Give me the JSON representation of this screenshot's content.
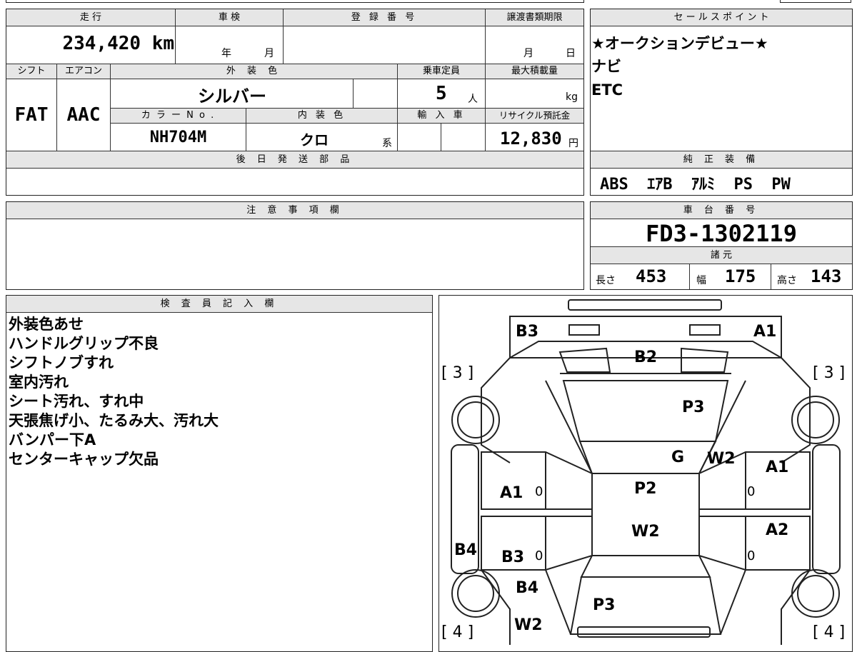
{
  "header": {
    "mileage_label": "走 行",
    "inspection_label": "車 検",
    "registration_label": "登 録 番 号",
    "transfer_label": "譲渡書類期限",
    "sales_points_label": "セ ー ル ス ポ イ ン ト"
  },
  "mileage": {
    "value": "234,420",
    "unit": "km"
  },
  "inspection": {
    "year": "年",
    "month": "月"
  },
  "transfer": {
    "month": "月",
    "day": "日"
  },
  "row2_labels": {
    "shift": "シフト",
    "aircon": "エアコン",
    "exterior_color": "外 装 色",
    "capacity": "乗車定員",
    "max_load": "最大積載量"
  },
  "shift": "FAT",
  "aircon": "AAC",
  "exterior_color": "シルバー",
  "capacity": {
    "value": "5",
    "unit": "人"
  },
  "max_load_unit": "kg",
  "row3_labels": {
    "color_no": "カ ラ ー N o .",
    "interior": "内 装 色",
    "import": "輸 入 車",
    "recycle": "リサイクル預託金"
  },
  "color_no": "NH704M",
  "interior": {
    "value": "クロ",
    "suffix": "系"
  },
  "recycle": {
    "value": "12,830",
    "unit": "円"
  },
  "later_parts_label": "後 日 発 送 部 品",
  "sales_points": [
    "★オークションデビュー★",
    "ナビ",
    "ETC"
  ],
  "genuine_equipment_label": "純 正 装 備",
  "genuine_equipment": "ABS  ｴｱB  ｱﾙﾐ  PS  PW",
  "caution_label": "注 意 事 項 欄",
  "chassis_label": "車 台 番 号",
  "chassis_no": "FD3-1302119",
  "specs_label": "諸 元",
  "specs": {
    "length_label": "長さ",
    "length": "453",
    "width_label": "幅",
    "width": "175",
    "height_label": "高さ",
    "height": "143"
  },
  "inspector_label": "検 査 員 記 入 欄",
  "inspector_notes": [
    "外装色あせ",
    "ハンドルグリップ不良",
    "シフトノブすれ",
    "室内汚れ",
    "シート汚れ、すれ中",
    "天張焦げ小、たるみ大、汚れ大",
    "バンパー下A",
    "センターキャップ欠品"
  ],
  "diagram": {
    "tyre_front_left": "[ 3 ]",
    "tyre_front_right": "[ 3 ]",
    "tyre_rear_left": "[ 4 ]",
    "tyre_rear_right": "[ 4 ]",
    "marks": {
      "b3_front": "B3",
      "a1_front": "A1",
      "b2": "B2",
      "p3_hood": "P3",
      "g": "G",
      "w2_glass": "W2",
      "a1_right_door": "A1",
      "p2": "P2",
      "a1_left_door": "A1",
      "w2_roof": "W2",
      "a2_right": "A2",
      "b4_left": "B4",
      "b3_left": "B3",
      "b4_rear": "B4",
      "p3_trunk": "P3",
      "w2_rear": "W2",
      "zero1": "0",
      "zero2": "0",
      "zero3": "0",
      "zero4": "0"
    }
  },
  "colors": {
    "header_bg": "#e6e6e6",
    "border": "#222222"
  }
}
